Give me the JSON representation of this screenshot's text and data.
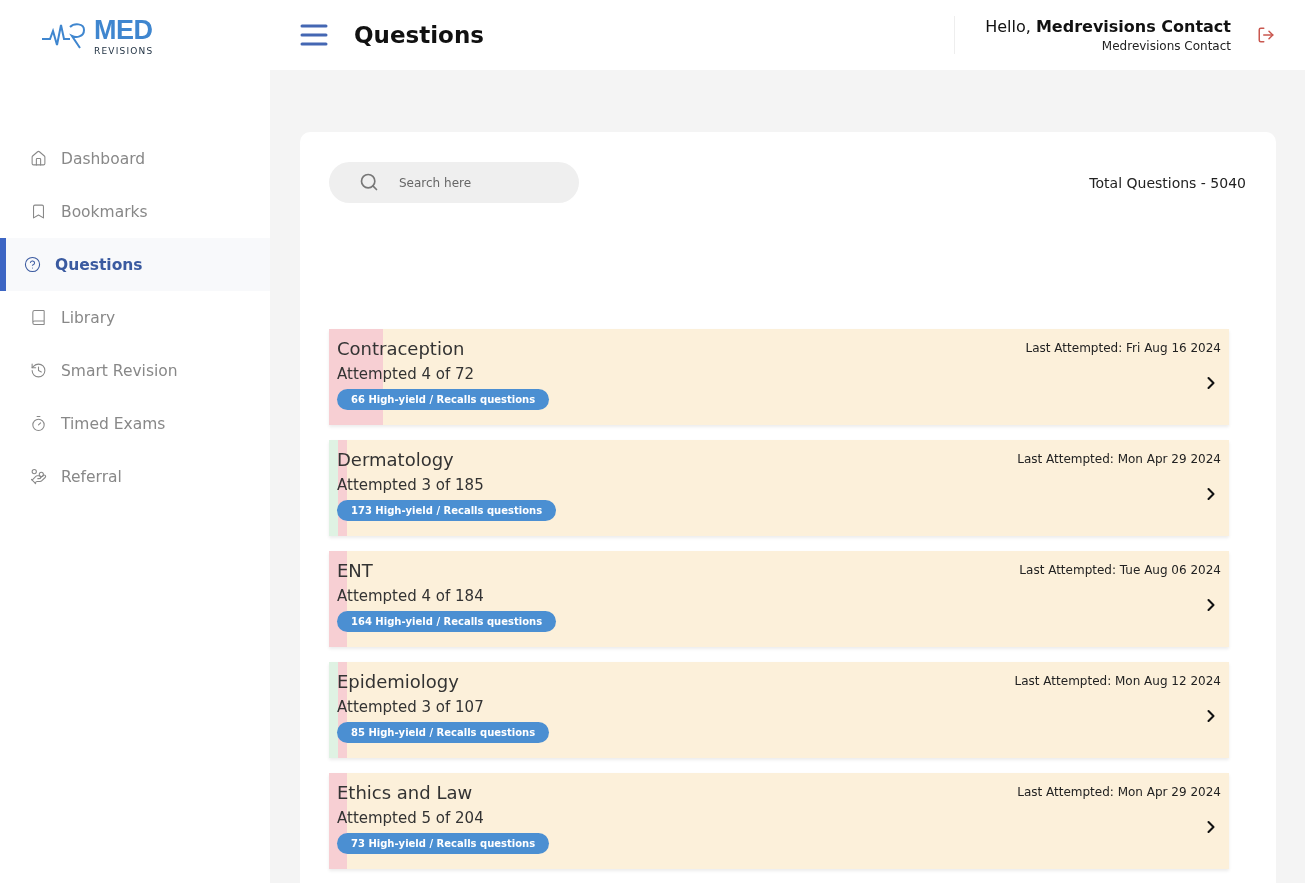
{
  "logo": {
    "main": "MED",
    "sub": "REVISIONS"
  },
  "header": {
    "title": "Questions",
    "greeting": "Hello, **Medrevisions Contact**",
    "user_name": "Medrevisions Contact"
  },
  "sidebar": {
    "items": [
      {
        "label": "Dashboard",
        "selected": false
      },
      {
        "label": "Bookmarks",
        "selected": false
      },
      {
        "label": "Questions",
        "selected": true
      },
      {
        "label": "Library",
        "selected": false
      },
      {
        "label": "Smart Revision",
        "selected": false
      },
      {
        "label": "Timed Exams",
        "selected": false
      },
      {
        "label": "Referral",
        "selected": false
      }
    ]
  },
  "search": {
    "placeholder": "Search here"
  },
  "total": "Total Questions - 5040",
  "topics": [
    {
      "name": "Contraception",
      "attempted": "Attempted 4 of 72",
      "badge": "66 High-yield / Recalls questions",
      "last_attempted": "Last Attempted: Fri Aug 16 2024",
      "progress": [
        {
          "kind": "incorrect",
          "level": 0.06
        }
      ]
    },
    {
      "name": "Dermatology",
      "attempted": "Attempted 3 of 185",
      "badge": "173 High-yield / Recalls questions",
      "last_attempted": "Last Attempted: Mon Apr 29 2024",
      "progress": [
        {
          "kind": "correct",
          "level": 0.01
        },
        {
          "kind": "incorrect",
          "level": 0.01
        }
      ]
    },
    {
      "name": "ENT",
      "attempted": "Attempted 4 of 184",
      "badge": "164 High-yield / Recalls questions",
      "last_attempted": "Last Attempted: Tue Aug 06 2024",
      "progress": [
        {
          "kind": "incorrect",
          "level": 0.02
        }
      ]
    },
    {
      "name": "Epidemiology",
      "attempted": "Attempted 3 of 107",
      "badge": "85 High-yield / Recalls questions",
      "last_attempted": "Last Attempted: Mon Aug 12 2024",
      "progress": [
        {
          "kind": "correct",
          "level": 0.01
        },
        {
          "kind": "incorrect",
          "level": 0.01
        }
      ]
    },
    {
      "name": "Ethics and Law",
      "attempted": "Attempted 5 of 204",
      "badge": "73 High-yield / Recalls questions",
      "last_attempted": "Last Attempted: Mon Apr 29 2024",
      "progress": [
        {
          "kind": "incorrect",
          "level": 0.02
        }
      ]
    }
  ]
}
